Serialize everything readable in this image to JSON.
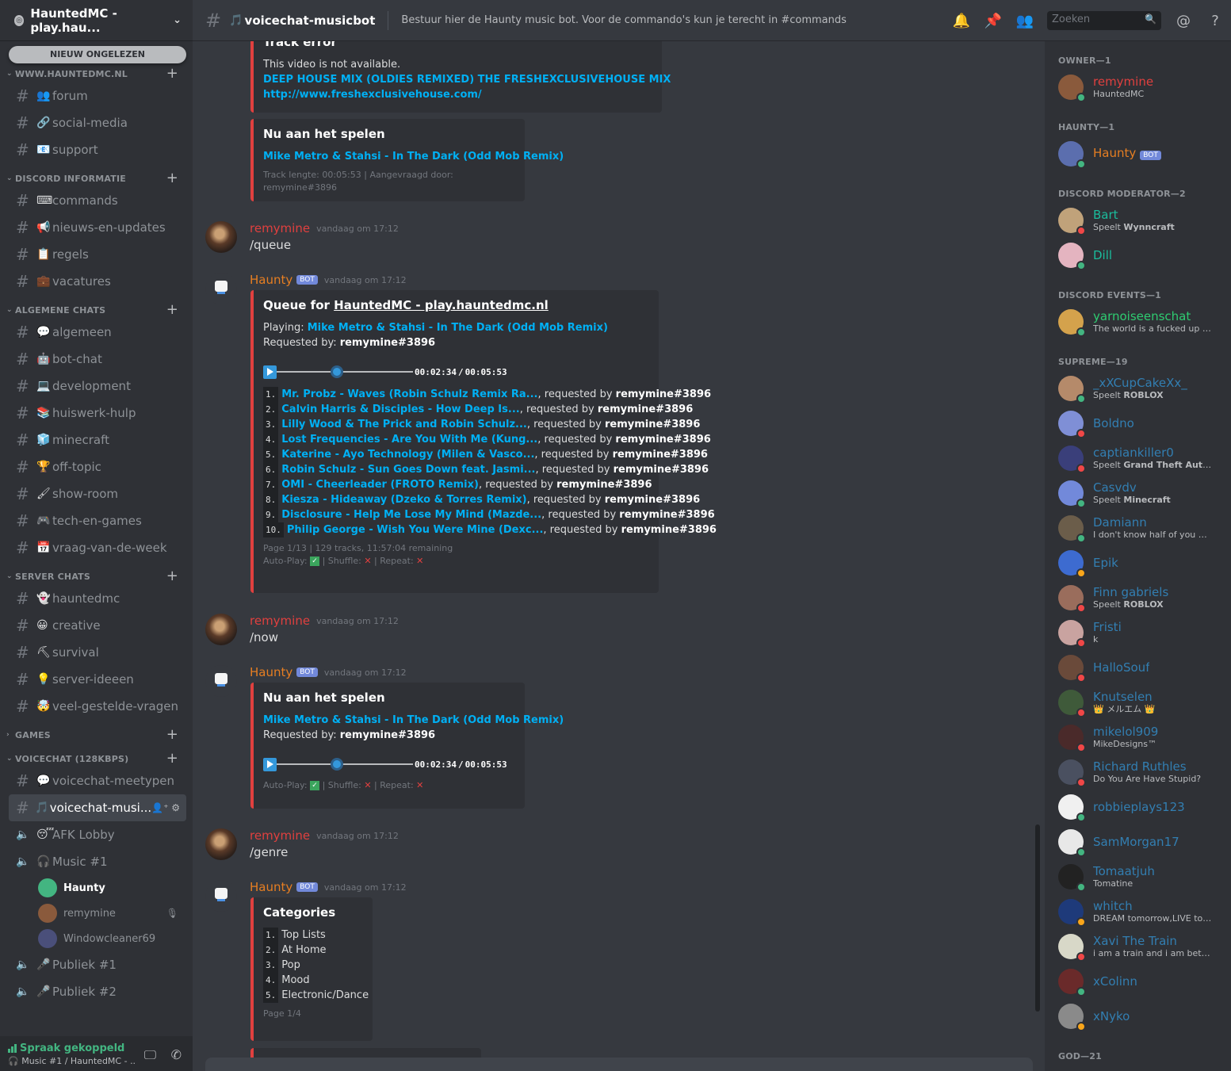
{
  "guild": {
    "name": "HauntedMC - play.hau...",
    "unread_pill": "NIEUW ONGELEZEN"
  },
  "sidebar": {
    "categories": [
      {
        "name": "WWW.HAUNTEDMC.NL",
        "channels": [
          {
            "icon": "👥",
            "name": "forum"
          },
          {
            "icon": "🔗",
            "name": "social-media"
          },
          {
            "icon": "📧",
            "name": "support"
          }
        ]
      },
      {
        "name": "DISCORD INFORMATIE",
        "channels": [
          {
            "icon": "⌨",
            "name": "commands"
          },
          {
            "icon": "📢",
            "name": "nieuws-en-updates"
          },
          {
            "icon": "📋",
            "name": "regels"
          },
          {
            "icon": "💼",
            "name": "vacatures"
          }
        ]
      },
      {
        "name": "ALGEMENE CHATS",
        "channels": [
          {
            "icon": "💬",
            "name": "algemeen"
          },
          {
            "icon": "🤖",
            "name": "bot-chat"
          },
          {
            "icon": "💻",
            "name": "development"
          },
          {
            "icon": "📚",
            "name": "huiswerk-hulp"
          },
          {
            "icon": "🧊",
            "name": "minecraft"
          },
          {
            "icon": "🏆",
            "name": "off-topic"
          },
          {
            "icon": "🖌",
            "name": "show-room"
          },
          {
            "icon": "🎮",
            "name": "tech-en-games"
          },
          {
            "icon": "📅",
            "name": "vraag-van-de-week"
          }
        ]
      },
      {
        "name": "SERVER CHATS",
        "channels": [
          {
            "icon": "👻",
            "name": "hauntedmc"
          },
          {
            "icon": "😀",
            "name": "creative"
          },
          {
            "icon": "⛏",
            "name": "survival"
          },
          {
            "icon": "💡",
            "name": "server-ideeen"
          },
          {
            "icon": "🤯",
            "name": "veel-gestelde-vragen"
          }
        ]
      },
      {
        "name": "GAMES",
        "collapsed": true,
        "channels": []
      },
      {
        "name": "VOICECHAT (128KBPS)",
        "channels": [
          {
            "icon": "💬",
            "name": "voicechat-meetypen"
          },
          {
            "icon": "🎵",
            "name": "voicechat-musi...",
            "active": true
          }
        ]
      }
    ],
    "voice_channels": [
      {
        "icon": "😴",
        "name": "AFK Lobby"
      },
      {
        "icon": "🎧",
        "name": "Music #1",
        "users": [
          "Haunty",
          "remymine",
          "Windowcleaner69"
        ]
      },
      {
        "icon": "🎤",
        "name": "Publiek #1"
      },
      {
        "icon": "🎤",
        "name": "Publiek #2"
      }
    ],
    "voice_panel": {
      "status": "Spraak gekoppeld",
      "detail": "Music #1 / HauntedMC - ..."
    }
  },
  "topbar": {
    "channel": "voicechat-musicbot",
    "topic": "Bestuur hier de Haunty music bot. Voor de commando's kun je terecht in #commands",
    "search_placeholder": "Zoeken"
  },
  "messages": {
    "error_embed": {
      "title": "Track error",
      "text": "This video is not available.",
      "link1": "DEEP HOUSE MIX (OLDIES REMIXED) THE FRESHEXCLUSIVEHOUSE MIX",
      "link2": "http://www.freshexclusivehouse.com/"
    },
    "now_playing_1": {
      "title": "Nu aan het spelen",
      "track": "Mike Metro & Stahsi - In The Dark (Odd Mob Remix)",
      "footer": "Track lengte: 00:05:53 | Aangevraagd door: remymine#3896"
    },
    "msg1": {
      "author": "remymine",
      "time": "vandaag om 17:12",
      "text": "/queue"
    },
    "queue": {
      "author": "Haunty",
      "bot": "BOT",
      "time": "vandaag om 17:12",
      "title_prefix": "Queue for ",
      "title_link": "HauntedMC - play.hauntedmc.nl",
      "playing_label": "Playing: ",
      "playing_track": "Mike Metro & Stahsi - In The Dark (Odd Mob Remix)",
      "requested_label": "Requested by: ",
      "requested_user": "remymine#3896",
      "time_current": "00:02:34",
      "time_sep": "/",
      "time_total": "00:05:53",
      "progress": 0.44,
      "items": [
        {
          "n": "1.",
          "track": "Mr. Probz - Waves (Robin Schulz Remix Ra...",
          "by": "remymine#3896"
        },
        {
          "n": "2.",
          "track": "Calvin Harris & Disciples - How Deep Is...",
          "by": "remymine#3896"
        },
        {
          "n": "3.",
          "track": "Lilly Wood & The Prick and Robin Schulz...",
          "by": "remymine#3896"
        },
        {
          "n": "4.",
          "track": "Lost Frequencies - Are You With Me (Kung...",
          "by": "remymine#3896"
        },
        {
          "n": "5.",
          "track": "Katerine - Ayo Technology (Milen & Vasco...",
          "by": "remymine#3896"
        },
        {
          "n": "6.",
          "track": "Robin Schulz - Sun Goes Down feat. Jasmi...",
          "by": "remymine#3896"
        },
        {
          "n": "7.",
          "track": "OMI - Cheerleader (FROTO Remix)",
          "by": "remymine#3896"
        },
        {
          "n": "8.",
          "track": "Kiesza - Hideaway (Dzeko & Torres Remix)",
          "by": "remymine#3896"
        },
        {
          "n": "9.",
          "track": "Disclosure - Help Me Lose My Mind (Mazde...",
          "by": "remymine#3896"
        },
        {
          "n": "10.",
          "track": "Philip George - Wish You Were Mine (Dexc...",
          "by": "remymine#3896"
        }
      ],
      "requested_word": ", requested by ",
      "footer": "Page 1/13 | 129 tracks, 11:57:04 remaining",
      "autoplay": "Auto-Play:",
      "shuffle": "| Shuffle:",
      "repeat": "| Repeat:"
    },
    "msg2": {
      "author": "remymine",
      "time": "vandaag om 17:12",
      "text": "/now"
    },
    "now_playing_2": {
      "author": "Haunty",
      "bot": "BOT",
      "time": "vandaag om 17:12",
      "title": "Nu aan het spelen",
      "track": "Mike Metro & Stahsi - In The Dark (Odd Mob Remix)",
      "requested_label": "Requested by: ",
      "requested_user": "remymine#3896",
      "time_current": "00:02:34",
      "time_sep": "/",
      "time_total": "00:05:53",
      "progress": 0.44,
      "autoplay": "Auto-Play:",
      "shuffle": "| Shuffle:",
      "repeat": "| Repeat:"
    },
    "msg3": {
      "author": "remymine",
      "time": "vandaag om 17:12",
      "text": "/genre"
    },
    "categories": {
      "author": "Haunty",
      "bot": "BOT",
      "time": "vandaag om 17:12",
      "title": "Categories",
      "items": [
        {
          "n": "1.",
          "name": "Top Lists"
        },
        {
          "n": "2.",
          "name": "At Home"
        },
        {
          "n": "3.",
          "name": "Pop"
        },
        {
          "n": "4.",
          "name": "Mood"
        },
        {
          "n": "5.",
          "name": "Electronic/Dance"
        }
      ],
      "footer": "Page 1/4"
    }
  },
  "members": {
    "groups": [
      {
        "name": "OWNER—1",
        "members": [
          {
            "name": "remymine",
            "activity": "HauntedMC",
            "status": "online",
            "color": "owner"
          }
        ]
      },
      {
        "name": "HAUNTY—1",
        "members": [
          {
            "name": "Haunty",
            "bot": "BOT",
            "status": "online",
            "color": "haunty"
          }
        ]
      },
      {
        "name": "DISCORD MODERATOR—2",
        "members": [
          {
            "name": "Bart",
            "activity_prefix": "Speelt ",
            "activity": "Wynncraft",
            "status": "dnd",
            "color": "mod"
          },
          {
            "name": "Dill",
            "status": "online",
            "color": "mod"
          }
        ]
      },
      {
        "name": "DISCORD EVENTS—1",
        "members": [
          {
            "name": "yarnoiseenschat",
            "activity": "The world is a fucked up pl...",
            "status": "online",
            "color": "events"
          }
        ]
      },
      {
        "name": "SUPREME—19",
        "members": [
          {
            "name": "_xXCupCakeXx_",
            "activity_prefix": "Speelt ",
            "activity": "ROBLOX",
            "status": "online"
          },
          {
            "name": "Boldno",
            "status": "dnd"
          },
          {
            "name": "captiankiller0",
            "activity_prefix": "Speelt ",
            "activity": "Grand Theft Auto V",
            "status": "dnd"
          },
          {
            "name": "Casvdv",
            "activity_prefix": "Speelt ",
            "activity": "Minecraft",
            "status": "online"
          },
          {
            "name": "Damiann",
            "activity": "I don't know half of you hal...",
            "status": "online"
          },
          {
            "name": "Epik",
            "status": "idle"
          },
          {
            "name": "Finn gabriels",
            "activity_prefix": "Speelt ",
            "activity": "ROBLOX",
            "status": "dnd"
          },
          {
            "name": "Fristi",
            "activity": "k",
            "status": "dnd"
          },
          {
            "name": "HalloSouf",
            "status": "dnd"
          },
          {
            "name": "Knutselen",
            "activity": "👑 メルエム 👑",
            "status": "dnd"
          },
          {
            "name": "mikelol909",
            "activity": "MikeDesigns™",
            "status": "dnd"
          },
          {
            "name": "Richard Ruthles",
            "activity": "Do You Are Have Stupid?",
            "status": "dnd"
          },
          {
            "name": "robbieplays123",
            "status": "online"
          },
          {
            "name": "SamMorgan17",
            "status": "online"
          },
          {
            "name": "Tomaatjuh",
            "activity": "Tomatine",
            "status": "online"
          },
          {
            "name": "whitch",
            "activity": "DREAM tomorrow,LIVE today",
            "status": "idle"
          },
          {
            "name": "Xavi The Train",
            "activity": "i am a train and i am better tha...",
            "status": "dnd"
          },
          {
            "name": "xColinn",
            "status": "online"
          },
          {
            "name": "xNyko",
            "status": "idle"
          }
        ]
      },
      {
        "name": "GOD—21",
        "members": []
      }
    ]
  },
  "colors": {
    "accent": "#7289da",
    "embed_bar": "#e0403f",
    "link": "#00b0f4",
    "owner": "#e0403f",
    "haunty": "#e67e22",
    "mod": "#1abc9c",
    "events": "#2ecc71",
    "supreme": "#3498db"
  }
}
